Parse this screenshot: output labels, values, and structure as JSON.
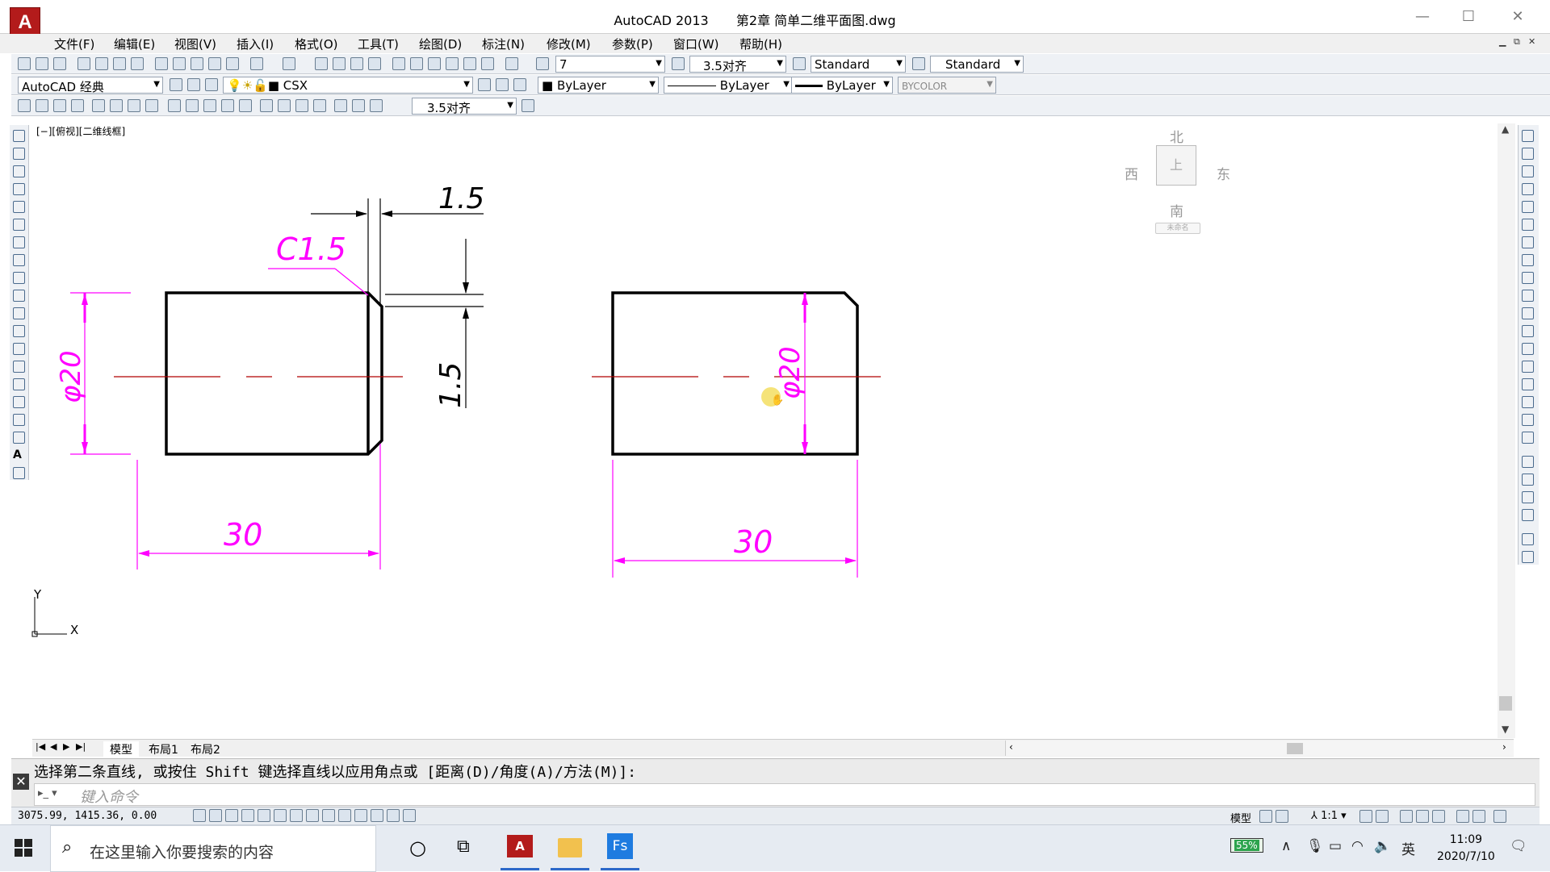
{
  "window": {
    "app_name": "AutoCAD 2013",
    "document_title": "第2章 简单二维平面图.dwg",
    "logo_letter": "A"
  },
  "menu": [
    "文件(F)",
    "编辑(E)",
    "视图(V)",
    "插入(I)",
    "格式(O)",
    "工具(T)",
    "绘图(D)",
    "标注(N)",
    "修改(M)",
    "参数(P)",
    "窗口(W)",
    "帮助(H)"
  ],
  "toolbar1": {
    "text_height": "7",
    "dim_style": "3.5对齐",
    "table_style": "Standard",
    "mleader_style": "Standard"
  },
  "toolbar2": {
    "workspace": "AutoCAD 经典",
    "layer": "CSX",
    "color": "ByLayer",
    "linetype": "ByLayer",
    "lineweight": "ByLayer",
    "plotstyle": "BYCOLOR"
  },
  "toolbar3": {
    "dim_style": "3.5对齐"
  },
  "viewport": {
    "label": "[−][俯视][二维线框]"
  },
  "viewcube": {
    "north": "北",
    "south": "南",
    "east": "东",
    "west": "西",
    "face": "上",
    "wcs": "未命名"
  },
  "drawing": {
    "left_part": {
      "chamfer_label": "C1.5",
      "top_dim": "1.5",
      "side_dim": "1.5",
      "diameter": "φ20",
      "length": "30"
    },
    "right_part": {
      "diameter": "φ20",
      "length": "30"
    },
    "ucs": {
      "x": "X",
      "y": "Y"
    }
  },
  "layout_tabs": [
    "模型",
    "布局1",
    "布局2"
  ],
  "command": {
    "history": "选择第二条直线, 或按住 Shift 键选择直线以应用角点或 [距离(D)/角度(A)/方法(M)]:",
    "placeholder": "键入命令"
  },
  "status": {
    "coordinates": "3075.99, 1415.36, 0.00",
    "model_label": "模型",
    "annotation_scale": "1:1"
  },
  "taskbar": {
    "search_placeholder": "在这里输入你要搜索的内容",
    "battery": "55%",
    "ime": "英",
    "time": "11:09",
    "date": "2020/7/10"
  },
  "colors": {
    "dimension": "#ff00ff",
    "centerline": "#b00000",
    "geometry": "#000000",
    "accent": "#2c68c9"
  }
}
